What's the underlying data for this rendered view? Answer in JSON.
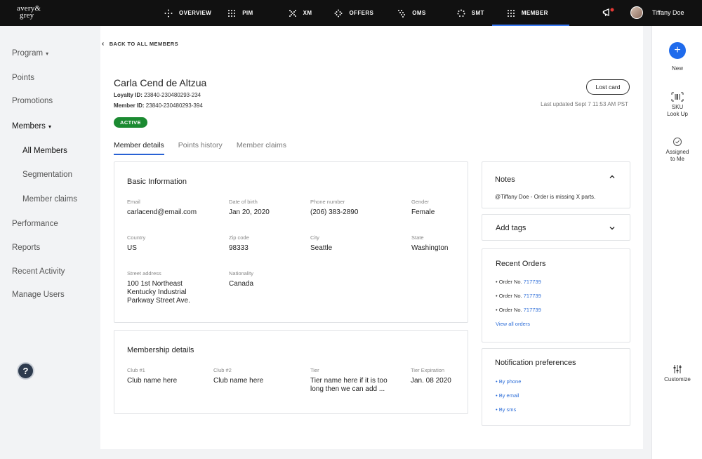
{
  "brand": {
    "logo_line1": "avery&",
    "logo_line2": "grey"
  },
  "topnav": {
    "items": [
      {
        "label": "OVERVIEW",
        "icon": "compass-icon"
      },
      {
        "label": "PIM",
        "icon": "grid-dots-icon"
      },
      {
        "label": "XM",
        "icon": "cross-dots-icon"
      },
      {
        "label": "OFFERS",
        "icon": "diamond-dots-icon"
      },
      {
        "label": "OMS",
        "icon": "diagonal-dots-icon"
      },
      {
        "label": "SMT",
        "icon": "ring-dots-icon"
      },
      {
        "label": "MEMBER",
        "icon": "grid-dots-icon"
      }
    ],
    "active": "MEMBER",
    "user_name": "Tiffany Doe"
  },
  "sidebar": {
    "items": [
      {
        "label": "Program",
        "caret": "▾"
      },
      {
        "label": "Points"
      },
      {
        "label": "Promotions"
      },
      {
        "label": "Members",
        "caret": "▾"
      },
      {
        "label": "All Members"
      },
      {
        "label": "Segmentation"
      },
      {
        "label": "Member claims"
      },
      {
        "label": "Performance"
      },
      {
        "label": "Reports"
      },
      {
        "label": "Recent Activity"
      },
      {
        "label": "Manage Users"
      }
    ],
    "help_label": "?"
  },
  "page": {
    "back_label": "BACK TO ALL MEMBERS",
    "member_name": "Carla Cend de Altzua",
    "loyalty_id_label": "Loyalty ID:",
    "loyalty_id": "23840-230480293-234",
    "member_id_label": "Member ID:",
    "member_id": "23840-230480293-394",
    "status": "ACTIVE",
    "lost_card_label": "Lost card",
    "last_updated": "Last updated Sept 7 11:53 AM PST",
    "tabs": [
      "Member details",
      "Points history",
      "Member claims"
    ],
    "active_tab": "Member details"
  },
  "basic_info": {
    "title": "Basic Information",
    "email_label": "Email",
    "email": "carlacend@email.com",
    "dob_label": "Date of birth",
    "dob": "Jan 20, 2020",
    "phone_label": "Phone number",
    "phone": "(206) 383-2890",
    "gender_label": "Gender",
    "gender": "Female",
    "country_label": "Country",
    "country": "US",
    "zip_label": "Zip code",
    "zip": "98333",
    "city_label": "City",
    "city": "Seattle",
    "state_label": "State",
    "state": "Washington",
    "street_label": "Street address",
    "street_line1": "100 1st Northeast",
    "street_line2": "Kentucky Industrial",
    "street_line3": "Parkway Street Ave.",
    "nationality_label": "Nationality",
    "nationality": "Canada"
  },
  "membership": {
    "title": "Membership details",
    "club1_label": "Club #1",
    "club1": "Club name here",
    "club2_label": "Club #2",
    "club2": "Club name here",
    "tier_label": "Tier",
    "tier_line1": "Tier name here if it is too",
    "tier_line2": "long then we can add ...",
    "tier_exp_label": "Tier Expiration",
    "tier_exp": "Jan. 08 2020"
  },
  "notes": {
    "title": "Notes",
    "text": "@Tiffany Doe - Order is missing X parts."
  },
  "tags": {
    "title": "Add tags"
  },
  "orders": {
    "title": "Recent Orders",
    "prefix": "• Order No.",
    "items": [
      "717739",
      "717739",
      "717739"
    ],
    "view_all": "View all orders"
  },
  "notifications": {
    "title": "Notification preferences",
    "items": [
      "• By phone",
      "• By email",
      "• By sms"
    ]
  },
  "rail": {
    "new_label": "New",
    "sku_line1": "SKU",
    "sku_line2": "Look Up",
    "assigned_line1": "Assigned",
    "assigned_line2": "to Me",
    "customize_label": "Customize"
  },
  "colors": {
    "accent": "#2962d4",
    "active_badge": "#1b8a31",
    "topbar": "#111111",
    "link": "#2f6fd8"
  }
}
